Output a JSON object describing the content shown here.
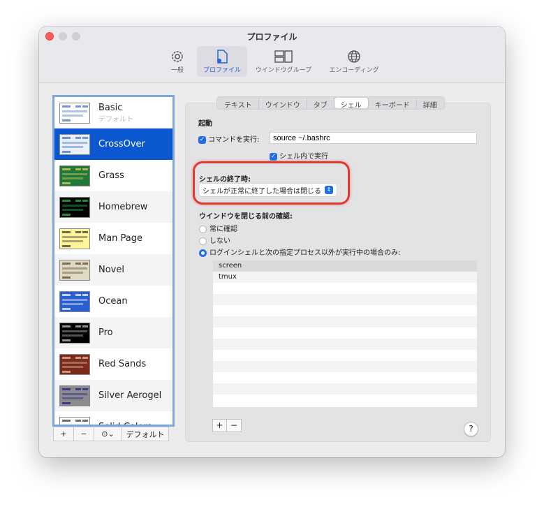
{
  "window": {
    "title": "プロファイル"
  },
  "toolbar": [
    {
      "label": "一般",
      "icon": "gear-icon"
    },
    {
      "label": "プロファイル",
      "icon": "profile-document-icon",
      "selected": true
    },
    {
      "label": "ウインドウグループ",
      "icon": "window-group-icon"
    },
    {
      "label": "エンコーディング",
      "icon": "globe-icon"
    }
  ],
  "profiles": [
    {
      "name": "Basic",
      "sub": "デフォルト",
      "bg": "#ffffff",
      "fg": "#3a6bbf"
    },
    {
      "name": "CrossOver",
      "bg": "#e8f0fa",
      "fg": "#3a6bbf",
      "selected": true
    },
    {
      "name": "Grass",
      "bg": "#1f7a3a",
      "fg": "#f0d060"
    },
    {
      "name": "Homebrew",
      "bg": "#000000",
      "fg": "#2cc84a"
    },
    {
      "name": "Man Page",
      "bg": "#fef49c",
      "fg": "#333333"
    },
    {
      "name": "Novel",
      "bg": "#dfdbc3",
      "fg": "#5a3c2a"
    },
    {
      "name": "Ocean",
      "bg": "#2a5fcf",
      "fg": "#ffffff"
    },
    {
      "name": "Pro",
      "bg": "#000000",
      "fg": "#cccccc"
    },
    {
      "name": "Red Sands",
      "bg": "#7a2b1d",
      "fg": "#e8c8a0"
    },
    {
      "name": "Silver Aerogel",
      "bg": "#8c8c8c",
      "fg": "#1a1a8c"
    },
    {
      "name": "Solid Colors",
      "bg": "#ffffff",
      "fg": "#333333"
    }
  ],
  "list_buttons": {
    "add": "+",
    "remove": "−",
    "more": "⊙⌄",
    "default": "デフォルト"
  },
  "tabs": [
    {
      "label": "テキスト"
    },
    {
      "label": "ウインドウ"
    },
    {
      "label": "タブ"
    },
    {
      "label": "シェル",
      "selected": true
    },
    {
      "label": "キーボード"
    },
    {
      "label": "詳細"
    }
  ],
  "shell": {
    "startup_heading": "起動",
    "run_command_label": "コマンドを実行:",
    "run_command_checked": true,
    "command_value": "source ~/.bashrc",
    "run_in_shell_label": "シェル内で実行",
    "run_in_shell_checked": true,
    "on_exit_heading": "シェルの終了時:",
    "on_exit_value": "シェルが正常に終了した場合は閉じる",
    "confirm_heading": "ウインドウを閉じる前の確認:",
    "radios": [
      {
        "label": "常に確認",
        "checked": false
      },
      {
        "label": "しない",
        "checked": false
      },
      {
        "label": "ログインシェルと次の指定プロセス以外が実行中の場合のみ:",
        "checked": true
      }
    ],
    "processes": [
      "screen",
      "tmux"
    ],
    "add": "+",
    "remove": "−",
    "help": "?"
  },
  "colors": {
    "accent": "#1f6ee8",
    "selection": "#0b57d0",
    "highlight": "#e03a2e"
  }
}
